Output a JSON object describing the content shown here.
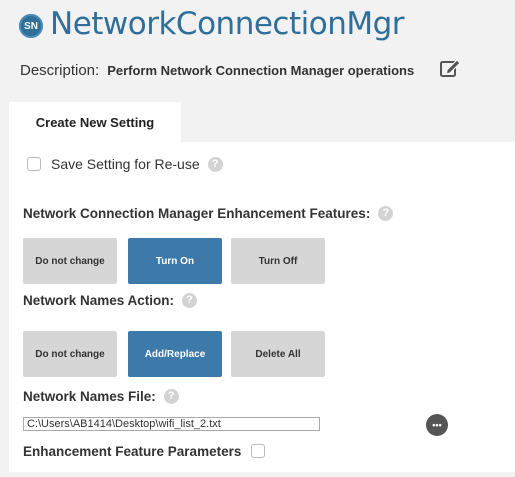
{
  "header": {
    "badge": "SN",
    "title": "NetworkConnectionMgr",
    "description_label": "Description:",
    "description": "Perform Network Connection Manager operations"
  },
  "tabs": [
    {
      "label": "Create New Setting"
    }
  ],
  "save_setting": {
    "label": "Save Setting for Re-use",
    "checked": false
  },
  "enhancement_features": {
    "label": "Network Connection Manager Enhancement Features:",
    "options": [
      "Do not change",
      "Turn On",
      "Turn Off"
    ],
    "selected": "Turn On"
  },
  "network_names_action": {
    "label": "Network Names Action:",
    "options": [
      "Do not change",
      "Add/Replace",
      "Delete All"
    ],
    "selected": "Add/Replace"
  },
  "network_names_file": {
    "label": "Network Names File:",
    "value": "C:\\Users\\AB1414\\Desktop\\wifi_list_2.txt",
    "more_glyph": "•••"
  },
  "enhancement_params": {
    "label": "Enhancement Feature Parameters",
    "checked": false
  },
  "help_glyph": "?",
  "colors": {
    "accent": "#2f6f9a",
    "selected_button": "#3e7aa9",
    "unselected_button": "#d6d6d6",
    "background": "#f2f2f2"
  },
  "icons": [
    "edit-icon",
    "help-icon",
    "more-options-icon"
  ]
}
